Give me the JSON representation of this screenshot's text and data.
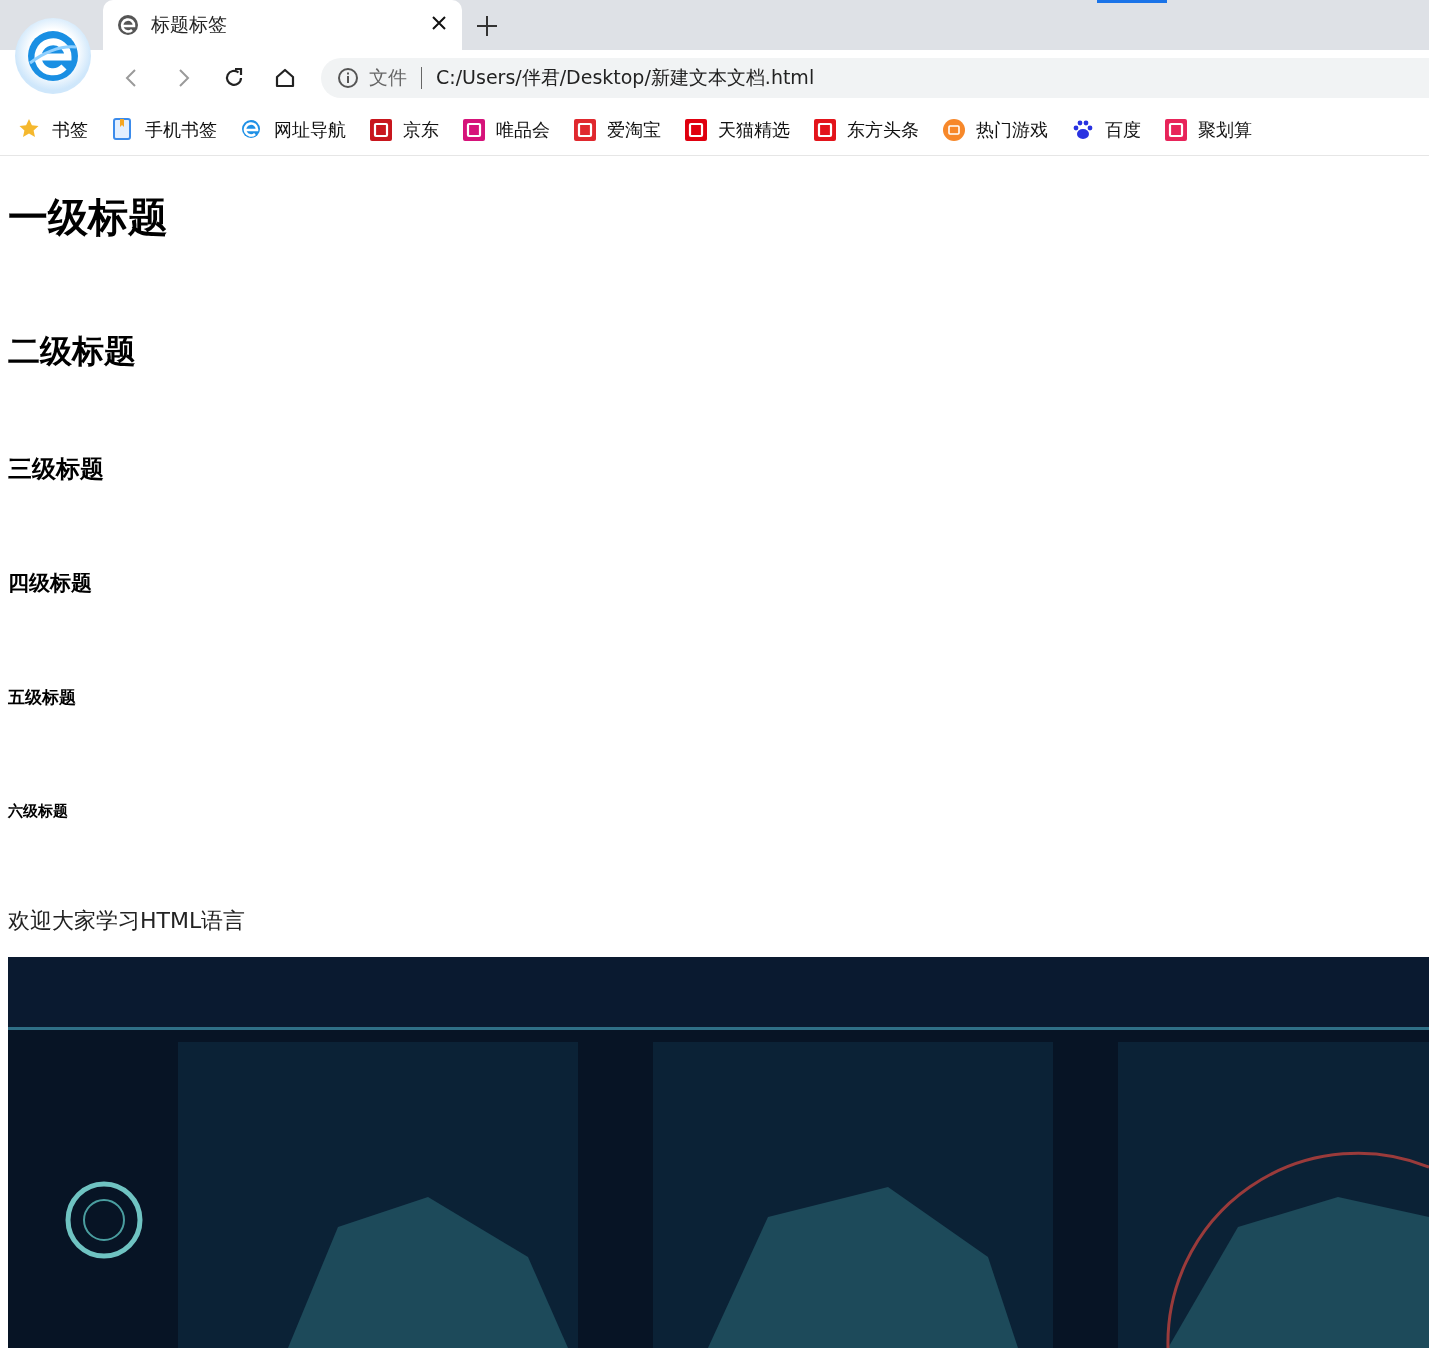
{
  "tab": {
    "title": "标题标签",
    "selected": true
  },
  "toolbar": [
    {
      "kind": "back",
      "disabled": true
    },
    {
      "kind": "forward",
      "disabled": true
    },
    {
      "kind": "reload",
      "disabled": false
    },
    {
      "kind": "home",
      "disabled": false
    }
  ],
  "address_bar": {
    "scheme_label": "文件",
    "url": "C:/Users/伴君/Desktop/新建文本文档.html"
  },
  "bookmarks": [
    {
      "label": "书签",
      "kind": "star",
      "color": "#f5b82e"
    },
    {
      "label": "手机书签",
      "kind": "phone",
      "color": "#3b8beb"
    },
    {
      "label": "网址导航",
      "kind": "browser",
      "color": "#1e90e6"
    },
    {
      "label": "京东",
      "kind": "square",
      "color": "#c8161d"
    },
    {
      "label": "唯品会",
      "kind": "square",
      "color": "#d6137a"
    },
    {
      "label": "爱淘宝",
      "kind": "square",
      "color": "#e0282e"
    },
    {
      "label": "天猫精选",
      "kind": "square",
      "color": "#e0000f"
    },
    {
      "label": "东方头条",
      "kind": "square",
      "color": "#e3141b"
    },
    {
      "label": "热门游戏",
      "kind": "round",
      "color": "#f7882a"
    },
    {
      "label": "百度",
      "kind": "paw",
      "color": "#2932e1"
    },
    {
      "label": "聚划算",
      "kind": "square",
      "color": "#e8245a"
    }
  ],
  "headings": [
    {
      "kind": "h1",
      "text": "一级标题"
    },
    {
      "kind": "h2",
      "text": "二级标题"
    },
    {
      "kind": "h3",
      "text": "三级标题"
    },
    {
      "kind": "h4",
      "text": "四级标题"
    },
    {
      "kind": "h5",
      "text": "五级标题"
    },
    {
      "kind": "h6",
      "text": "六级标题"
    }
  ],
  "paragraph": "欢迎大家学习HTML语言"
}
